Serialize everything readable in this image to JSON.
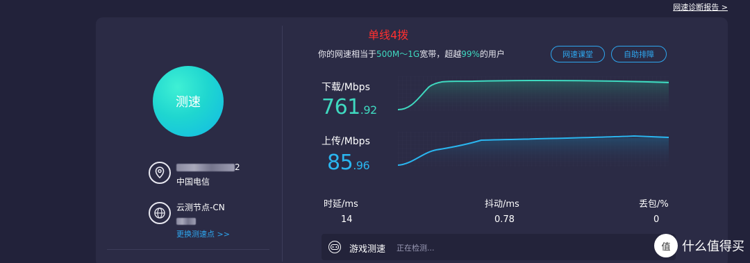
{
  "top_link": "网速诊断报告 >",
  "left": {
    "speed_button": "测速",
    "isp_suffix": "2",
    "isp_name": "中国电信",
    "node_label": "云测节点-CN",
    "change_node": "更换测速点 >>"
  },
  "main": {
    "title_red": "单线4拨",
    "headline": {
      "prefix": "你的网速相当于",
      "bandwidth": "500M～1G",
      "mid": "宽带，超越",
      "percent": "99%",
      "suffix": "的用户"
    },
    "btn_course": "网速课堂",
    "btn_troubleshoot": "自助排障",
    "download": {
      "label": "下载/Mbps",
      "int": "761",
      "dec": ".92",
      "color": "#3fd9c0"
    },
    "upload": {
      "label": "上传/Mbps",
      "int": "85",
      "dec": ".96",
      "color": "#2ab6f0"
    },
    "stats": {
      "latency_label": "时延/ms",
      "latency_value": "14",
      "jitter_label": "抖动/ms",
      "jitter_value": "0.78",
      "loss_label": "丢包/%",
      "loss_value": "0"
    },
    "game": {
      "label": "游戏测速",
      "status": "正在检测..."
    }
  },
  "watermark": {
    "icon": "值",
    "text": "什么值得买"
  }
}
